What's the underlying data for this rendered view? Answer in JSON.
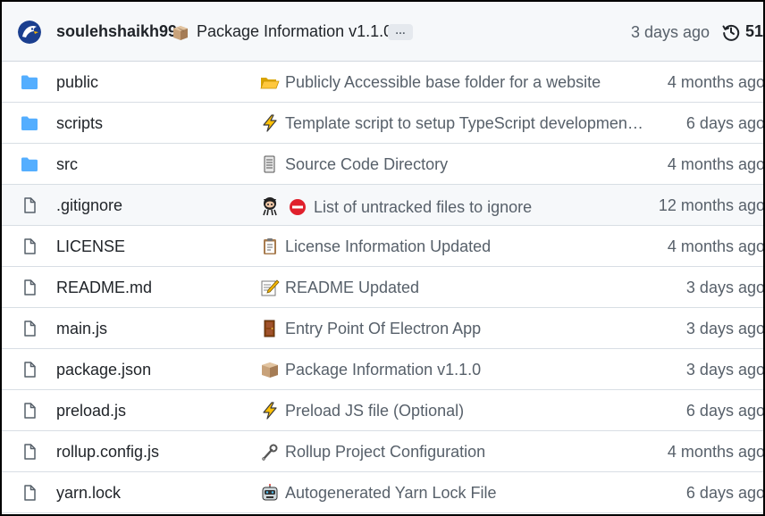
{
  "header": {
    "author": "soulehshaikh99",
    "message": "Package Information v1.1.0",
    "message_emoji": "package-emoji",
    "ellipsis": "…",
    "time": "3 days ago",
    "commits": "51"
  },
  "files": [
    {
      "name": "public",
      "type": "folder",
      "emoji": "open-folder-emoji",
      "message": "Publicly Accessible base folder for a website",
      "age": "4 months ago"
    },
    {
      "name": "scripts",
      "type": "folder",
      "emoji": "zap-emoji",
      "message": "Template script to setup TypeScript developmen…",
      "age": "6 days ago"
    },
    {
      "name": "src",
      "type": "folder",
      "emoji": "card-index-emoji",
      "message": "Source Code Directory",
      "age": "4 months ago"
    },
    {
      "name": ".gitignore",
      "type": "file",
      "emoji": "octocat-no-entry-emoji",
      "message": "List of untracked files to ignore",
      "age": "12 months ago"
    },
    {
      "name": "LICENSE",
      "type": "file",
      "emoji": "clipboard-emoji",
      "message": "License Information Updated",
      "age": "4 months ago"
    },
    {
      "name": "README.md",
      "type": "file",
      "emoji": "memo-emoji",
      "message": "README Updated",
      "age": "3 days ago"
    },
    {
      "name": "main.js",
      "type": "file",
      "emoji": "door-emoji",
      "message": "Entry Point Of Electron App",
      "age": "3 days ago"
    },
    {
      "name": "package.json",
      "type": "file",
      "emoji": "package-emoji",
      "message": "Package Information v1.1.0",
      "age": "3 days ago"
    },
    {
      "name": "preload.js",
      "type": "file",
      "emoji": "zap-emoji",
      "message": "Preload JS file (Optional)",
      "age": "6 days ago"
    },
    {
      "name": "rollup.config.js",
      "type": "file",
      "emoji": "wrench-emoji",
      "message": "Rollup Project Configuration",
      "age": "4 months ago"
    },
    {
      "name": "yarn.lock",
      "type": "file",
      "emoji": "robot-emoji",
      "message": "Autogenerated Yarn Lock File",
      "age": "6 days ago"
    }
  ],
  "colors": {
    "folder": "#54aeff",
    "header_bg": "#f6f8fa",
    "muted_text": "#57606a",
    "border": "#d0d7de"
  }
}
